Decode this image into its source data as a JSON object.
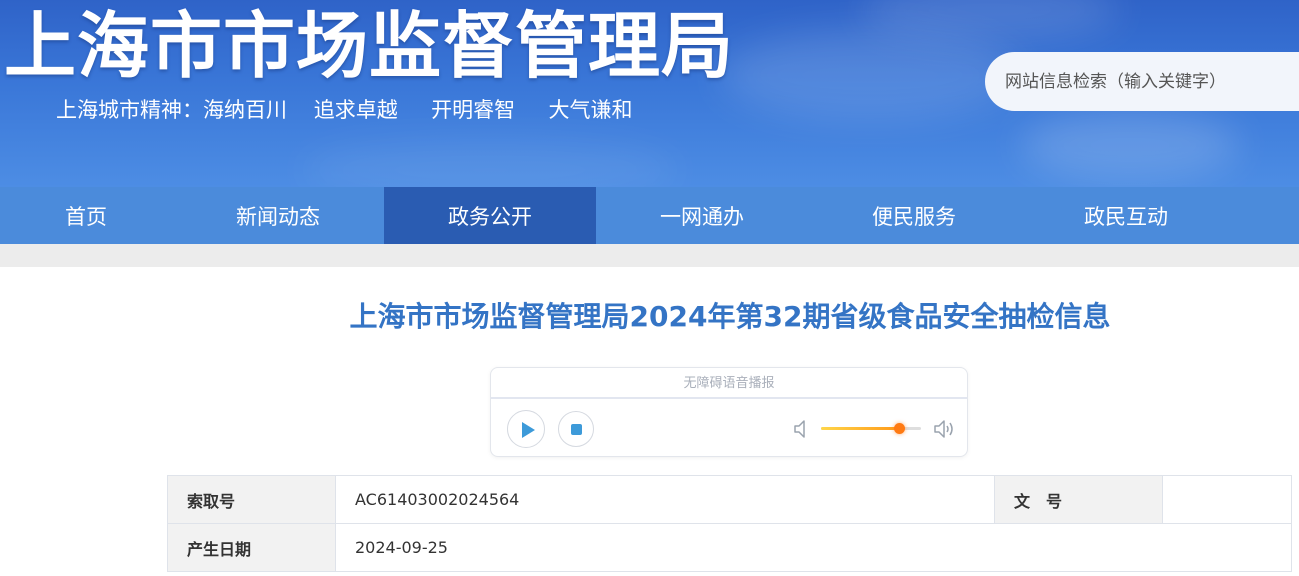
{
  "header": {
    "title": "上海市市场监督管理局",
    "slogan": "上海城市精神：海纳百川    追求卓越     开明睿智     大气谦和",
    "search_placeholder": "网站信息检索（输入关键字）"
  },
  "nav": {
    "items": [
      {
        "label": "首页"
      },
      {
        "label": "新闻动态"
      },
      {
        "label": "政务公开",
        "active": true
      },
      {
        "label": "一网通办"
      },
      {
        "label": "便民服务"
      },
      {
        "label": "政民互动"
      }
    ]
  },
  "article": {
    "title": "上海市市场监督管理局2024年第32期省级食品安全抽检信息"
  },
  "audio_player": {
    "label": "无障碍语音播报",
    "volume": 0.78,
    "icons": {
      "play": "play-icon",
      "stop": "stop-icon",
      "volume_low": "volume-low-icon",
      "volume_high": "volume-high-icon"
    }
  },
  "info_table": {
    "rows": [
      {
        "label": "索取号",
        "value": "AC61403002024564",
        "label2": "文　号",
        "value2": ""
      },
      {
        "label": "产生日期",
        "value": "2024-09-25"
      }
    ]
  },
  "colors": {
    "banner": "#3a77d8",
    "nav": "#4b8bdb",
    "nav_active": "#2a5cb2",
    "title": "#3474c5",
    "volume_accent": "#ff7a12"
  }
}
